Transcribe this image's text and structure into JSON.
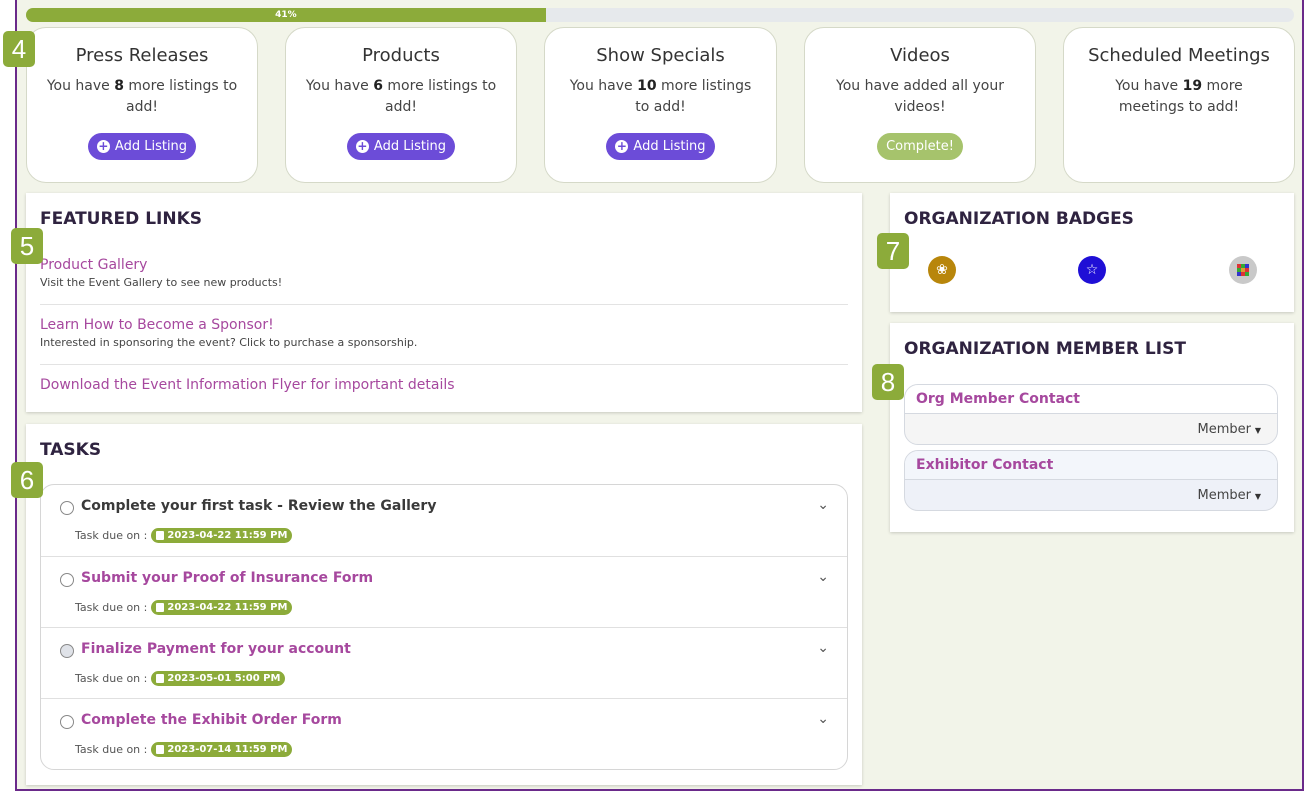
{
  "progress": {
    "percent": 41,
    "label": "41%"
  },
  "stat_cards": [
    {
      "title": "Press Releases",
      "prefix": "You have ",
      "count": "8",
      "suffix": " more listings to add!",
      "button": "Add Listing"
    },
    {
      "title": "Products",
      "prefix": "You have ",
      "count": "6",
      "suffix": " more listings to add!",
      "button": "Add Listing"
    },
    {
      "title": "Show Specials",
      "prefix": "You have ",
      "count": "10",
      "suffix": " more listings to add!",
      "button": "Add Listing"
    },
    {
      "title": "Videos",
      "text": "You have added all your videos!",
      "button": "Complete!"
    },
    {
      "title": "Scheduled Meetings",
      "prefix": "You have ",
      "count": "19",
      "suffix": " more meetings to add!"
    }
  ],
  "callouts": [
    "4",
    "5",
    "6",
    "7",
    "8"
  ],
  "featured_links": {
    "title": "FEATURED LINKS",
    "items": [
      {
        "link": "Product Gallery",
        "desc": "Visit the Event Gallery to see new products!"
      },
      {
        "link": "Learn How to Become a Sponsor!",
        "desc": "Interested in sponsoring the event? Click to purchase a sponsorship."
      },
      {
        "link": "Download the Event Information Flyer for important details"
      }
    ]
  },
  "tasks": {
    "title": "TASKS",
    "due_label": "Task due on :",
    "items": [
      {
        "name": "Complete your first task - Review the Gallery",
        "due": "2023-04-22 11:59 PM"
      },
      {
        "name": "Submit your Proof of Insurance Form",
        "due": "2023-04-22 11:59 PM"
      },
      {
        "name": "Finalize Payment for your account",
        "due": "2023-05-01 5:00 PM"
      },
      {
        "name": "Complete the Exhibit Order Form",
        "due": "2023-07-14 11:59 PM"
      }
    ]
  },
  "badges": {
    "title": "ORGANIZATION BADGES",
    "items": [
      {
        "icon": "award-ribbon-icon",
        "color": "#b8860b"
      },
      {
        "icon": "star-icon",
        "color": "#1f0fd6"
      },
      {
        "icon": "cube-icon",
        "color": "#c9c9c9"
      }
    ]
  },
  "members": {
    "title": "ORGANIZATION MEMBER LIST",
    "items": [
      {
        "name": "Org Member Contact",
        "role": "Member"
      },
      {
        "name": "Exhibitor Contact",
        "role": "Member"
      }
    ]
  },
  "colors": {
    "accent_green": "#8cab3a",
    "button_purple": "#6c4cd8",
    "link_magenta": "#a6489e",
    "frame_purple": "#6a2a8a"
  }
}
